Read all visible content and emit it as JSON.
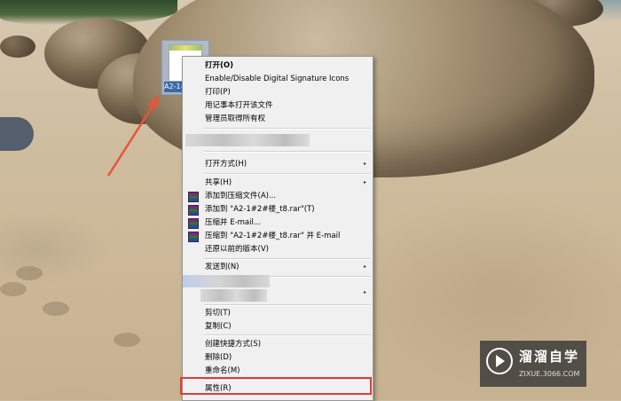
{
  "desktop_icon": {
    "label": "A2-1#2#楼_t8"
  },
  "context_menu": {
    "items": [
      {
        "label": "打开(O)",
        "bold": true
      },
      {
        "label": "Enable/Disable Digital Signature Icons"
      },
      {
        "label": "打印(P)"
      },
      {
        "label": "用记事本打开该文件"
      },
      {
        "label": "管理员取得所有权"
      },
      {
        "label": "打开方式(H)",
        "submenu": "▸"
      },
      {
        "label": "共享(H)",
        "submenu": "▸"
      },
      {
        "label": "添加到压缩文件(A)...",
        "icon": "winrar-icon"
      },
      {
        "label": "添加到 \"A2-1#2#楼_t8.rar\"(T)",
        "icon": "winrar-icon"
      },
      {
        "label": "压缩并 E-mail...",
        "icon": "winrar-icon"
      },
      {
        "label": "压缩到 \"A2-1#2#楼_t8.rar\" 并 E-mail",
        "icon": "winrar-icon"
      },
      {
        "label": "还原以前的版本(V)"
      },
      {
        "label": "发送到(N)",
        "submenu": "▸"
      },
      {
        "label": "剪切(T)"
      },
      {
        "label": "复制(C)"
      },
      {
        "label": "创建快捷方式(S)"
      },
      {
        "label": "删除(D)"
      },
      {
        "label": "重命名(M)"
      },
      {
        "label": "属性(R)",
        "highlighted": true
      }
    ],
    "blurred_submenu_arrow": "▸"
  },
  "watermark": {
    "title": "溜溜自学",
    "url": "ZIXUE.3066.COM"
  },
  "colors": {
    "highlight_border": "#e23a3a",
    "arrow": "#e8553a",
    "menu_bg": "#f0f0f0"
  }
}
